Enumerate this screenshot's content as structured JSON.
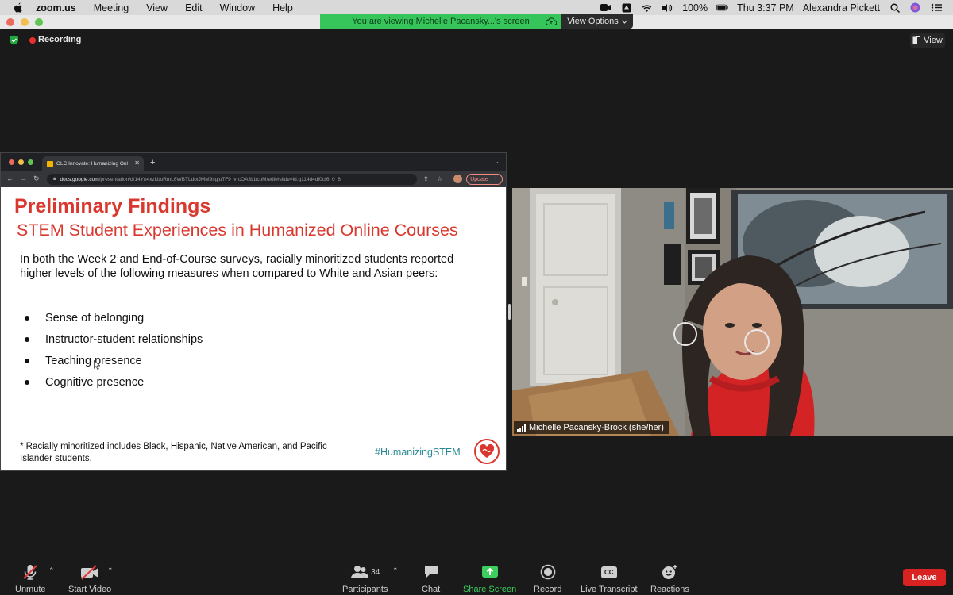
{
  "menubar": {
    "app": "zoom.us",
    "items": [
      "Meeting",
      "View",
      "Edit",
      "Window",
      "Help"
    ],
    "battery": "100%",
    "datetime": "Thu 3:37 PM",
    "user": "Alexandra Pickett"
  },
  "share_banner": {
    "text": "You are viewing Michelle Pacansky...'s screen",
    "view_options": "View Options"
  },
  "meeting": {
    "recording_label": "Recording",
    "view_label": "View"
  },
  "browser": {
    "tab_title": "OLC Innovate: Humanizing Onl",
    "url_host": "docs.google.com",
    "url_path": "/presentation/d/14Yn4xzkboRmL6WBTLdotJMM9sgluTF9_vrcOA3LbcoM/edit#slide=id.g114d4df0cf6_0_8",
    "update_label": "Update"
  },
  "slide": {
    "title": "Preliminary Findings",
    "subtitle": "STEM Student Experiences in Humanized Online Courses",
    "body": "In both the Week 2 and End-of-Course surveys, racially minoritized students reported higher levels of the following measures when compared to White and Asian peers:",
    "bullets": [
      "Sense of belonging",
      "Instructor-student relationships",
      "Teaching presence",
      "Cognitive presence"
    ],
    "footnote": "* Racially minoritized includes Black, Hispanic, Native American, and Pacific Islander students.",
    "hashtag": "#HumanizingSTEM"
  },
  "video": {
    "participant_name": "Michelle Pacansky-Brock (she/her)"
  },
  "toolbar": {
    "unmute": "Unmute",
    "start_video": "Start Video",
    "participants": "Participants",
    "participants_count": "34",
    "chat": "Chat",
    "share_screen": "Share Screen",
    "record": "Record",
    "live_transcript": "Live Transcript",
    "reactions": "Reactions",
    "leave": "Leave",
    "cc_badge": "CC"
  },
  "colors": {
    "share_green": "#36c55b",
    "slide_red": "#d9382f",
    "hashtag_teal": "#2a8a94",
    "leave_red": "#d92323",
    "toolbar_bg": "#1a1a1a"
  }
}
